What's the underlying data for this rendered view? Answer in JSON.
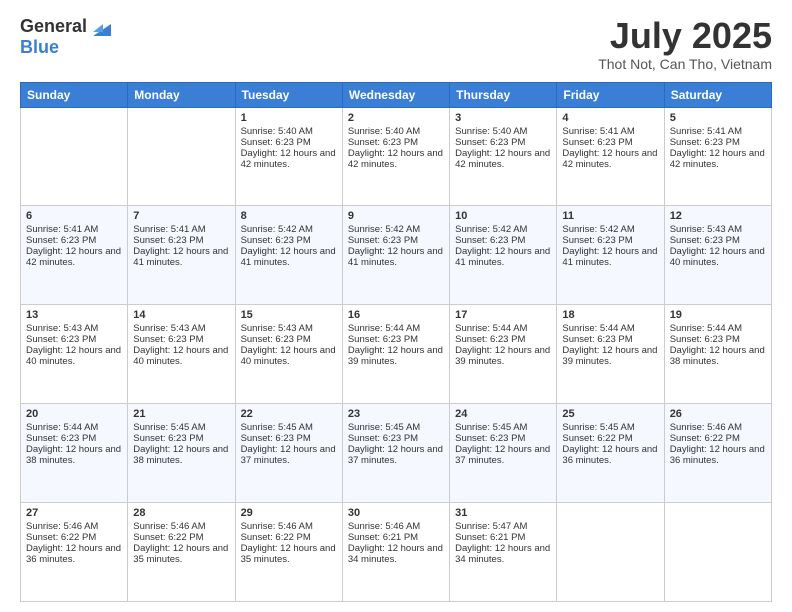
{
  "logo": {
    "general": "General",
    "blue": "Blue"
  },
  "header": {
    "month": "July 2025",
    "location": "Thot Not, Can Tho, Vietnam"
  },
  "days_of_week": [
    "Sunday",
    "Monday",
    "Tuesday",
    "Wednesday",
    "Thursday",
    "Friday",
    "Saturday"
  ],
  "weeks": [
    [
      {
        "day": "",
        "sunrise": "",
        "sunset": "",
        "daylight": ""
      },
      {
        "day": "",
        "sunrise": "",
        "sunset": "",
        "daylight": ""
      },
      {
        "day": "1",
        "sunrise": "Sunrise: 5:40 AM",
        "sunset": "Sunset: 6:23 PM",
        "daylight": "Daylight: 12 hours and 42 minutes."
      },
      {
        "day": "2",
        "sunrise": "Sunrise: 5:40 AM",
        "sunset": "Sunset: 6:23 PM",
        "daylight": "Daylight: 12 hours and 42 minutes."
      },
      {
        "day": "3",
        "sunrise": "Sunrise: 5:40 AM",
        "sunset": "Sunset: 6:23 PM",
        "daylight": "Daylight: 12 hours and 42 minutes."
      },
      {
        "day": "4",
        "sunrise": "Sunrise: 5:41 AM",
        "sunset": "Sunset: 6:23 PM",
        "daylight": "Daylight: 12 hours and 42 minutes."
      },
      {
        "day": "5",
        "sunrise": "Sunrise: 5:41 AM",
        "sunset": "Sunset: 6:23 PM",
        "daylight": "Daylight: 12 hours and 42 minutes."
      }
    ],
    [
      {
        "day": "6",
        "sunrise": "Sunrise: 5:41 AM",
        "sunset": "Sunset: 6:23 PM",
        "daylight": "Daylight: 12 hours and 42 minutes."
      },
      {
        "day": "7",
        "sunrise": "Sunrise: 5:41 AM",
        "sunset": "Sunset: 6:23 PM",
        "daylight": "Daylight: 12 hours and 41 minutes."
      },
      {
        "day": "8",
        "sunrise": "Sunrise: 5:42 AM",
        "sunset": "Sunset: 6:23 PM",
        "daylight": "Daylight: 12 hours and 41 minutes."
      },
      {
        "day": "9",
        "sunrise": "Sunrise: 5:42 AM",
        "sunset": "Sunset: 6:23 PM",
        "daylight": "Daylight: 12 hours and 41 minutes."
      },
      {
        "day": "10",
        "sunrise": "Sunrise: 5:42 AM",
        "sunset": "Sunset: 6:23 PM",
        "daylight": "Daylight: 12 hours and 41 minutes."
      },
      {
        "day": "11",
        "sunrise": "Sunrise: 5:42 AM",
        "sunset": "Sunset: 6:23 PM",
        "daylight": "Daylight: 12 hours and 41 minutes."
      },
      {
        "day": "12",
        "sunrise": "Sunrise: 5:43 AM",
        "sunset": "Sunset: 6:23 PM",
        "daylight": "Daylight: 12 hours and 40 minutes."
      }
    ],
    [
      {
        "day": "13",
        "sunrise": "Sunrise: 5:43 AM",
        "sunset": "Sunset: 6:23 PM",
        "daylight": "Daylight: 12 hours and 40 minutes."
      },
      {
        "day": "14",
        "sunrise": "Sunrise: 5:43 AM",
        "sunset": "Sunset: 6:23 PM",
        "daylight": "Daylight: 12 hours and 40 minutes."
      },
      {
        "day": "15",
        "sunrise": "Sunrise: 5:43 AM",
        "sunset": "Sunset: 6:23 PM",
        "daylight": "Daylight: 12 hours and 40 minutes."
      },
      {
        "day": "16",
        "sunrise": "Sunrise: 5:44 AM",
        "sunset": "Sunset: 6:23 PM",
        "daylight": "Daylight: 12 hours and 39 minutes."
      },
      {
        "day": "17",
        "sunrise": "Sunrise: 5:44 AM",
        "sunset": "Sunset: 6:23 PM",
        "daylight": "Daylight: 12 hours and 39 minutes."
      },
      {
        "day": "18",
        "sunrise": "Sunrise: 5:44 AM",
        "sunset": "Sunset: 6:23 PM",
        "daylight": "Daylight: 12 hours and 39 minutes."
      },
      {
        "day": "19",
        "sunrise": "Sunrise: 5:44 AM",
        "sunset": "Sunset: 6:23 PM",
        "daylight": "Daylight: 12 hours and 38 minutes."
      }
    ],
    [
      {
        "day": "20",
        "sunrise": "Sunrise: 5:44 AM",
        "sunset": "Sunset: 6:23 PM",
        "daylight": "Daylight: 12 hours and 38 minutes."
      },
      {
        "day": "21",
        "sunrise": "Sunrise: 5:45 AM",
        "sunset": "Sunset: 6:23 PM",
        "daylight": "Daylight: 12 hours and 38 minutes."
      },
      {
        "day": "22",
        "sunrise": "Sunrise: 5:45 AM",
        "sunset": "Sunset: 6:23 PM",
        "daylight": "Daylight: 12 hours and 37 minutes."
      },
      {
        "day": "23",
        "sunrise": "Sunrise: 5:45 AM",
        "sunset": "Sunset: 6:23 PM",
        "daylight": "Daylight: 12 hours and 37 minutes."
      },
      {
        "day": "24",
        "sunrise": "Sunrise: 5:45 AM",
        "sunset": "Sunset: 6:23 PM",
        "daylight": "Daylight: 12 hours and 37 minutes."
      },
      {
        "day": "25",
        "sunrise": "Sunrise: 5:45 AM",
        "sunset": "Sunset: 6:22 PM",
        "daylight": "Daylight: 12 hours and 36 minutes."
      },
      {
        "day": "26",
        "sunrise": "Sunrise: 5:46 AM",
        "sunset": "Sunset: 6:22 PM",
        "daylight": "Daylight: 12 hours and 36 minutes."
      }
    ],
    [
      {
        "day": "27",
        "sunrise": "Sunrise: 5:46 AM",
        "sunset": "Sunset: 6:22 PM",
        "daylight": "Daylight: 12 hours and 36 minutes."
      },
      {
        "day": "28",
        "sunrise": "Sunrise: 5:46 AM",
        "sunset": "Sunset: 6:22 PM",
        "daylight": "Daylight: 12 hours and 35 minutes."
      },
      {
        "day": "29",
        "sunrise": "Sunrise: 5:46 AM",
        "sunset": "Sunset: 6:22 PM",
        "daylight": "Daylight: 12 hours and 35 minutes."
      },
      {
        "day": "30",
        "sunrise": "Sunrise: 5:46 AM",
        "sunset": "Sunset: 6:21 PM",
        "daylight": "Daylight: 12 hours and 34 minutes."
      },
      {
        "day": "31",
        "sunrise": "Sunrise: 5:47 AM",
        "sunset": "Sunset: 6:21 PM",
        "daylight": "Daylight: 12 hours and 34 minutes."
      },
      {
        "day": "",
        "sunrise": "",
        "sunset": "",
        "daylight": ""
      },
      {
        "day": "",
        "sunrise": "",
        "sunset": "",
        "daylight": ""
      }
    ]
  ]
}
